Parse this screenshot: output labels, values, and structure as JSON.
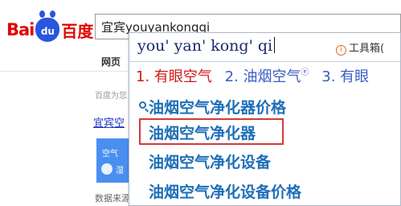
{
  "logo": {
    "left": "Bai",
    "paw": "du",
    "right": "百度"
  },
  "search": {
    "value_prefix": "宜宾",
    "value_typed": "youyankongqi"
  },
  "background": {
    "nav_tab": "网页",
    "hint": "百度为您",
    "link": "宜宾空",
    "card_title": "空气",
    "card_sub": "湿",
    "footer": "数据来源"
  },
  "ime": {
    "pinyin": "you' yan' kong' qi",
    "toolbox_icon": "i",
    "toolbox_label": "工具箱(",
    "candidates": [
      "1. 有眼空气",
      "2. 油烟空气",
      "3. 有眼"
    ],
    "candidate_marker": "ⓔ"
  },
  "suggestions": [
    "油烟空气净化器价格",
    "油烟空气净化器",
    "油烟空气净化设备",
    "油烟空气净化设备价格"
  ],
  "colors": {
    "brand_red": "#e10602",
    "brand_blue": "#2a55e0",
    "suggestion_blue": "#1f6fb8",
    "highlight_red": "#d23a3a"
  }
}
